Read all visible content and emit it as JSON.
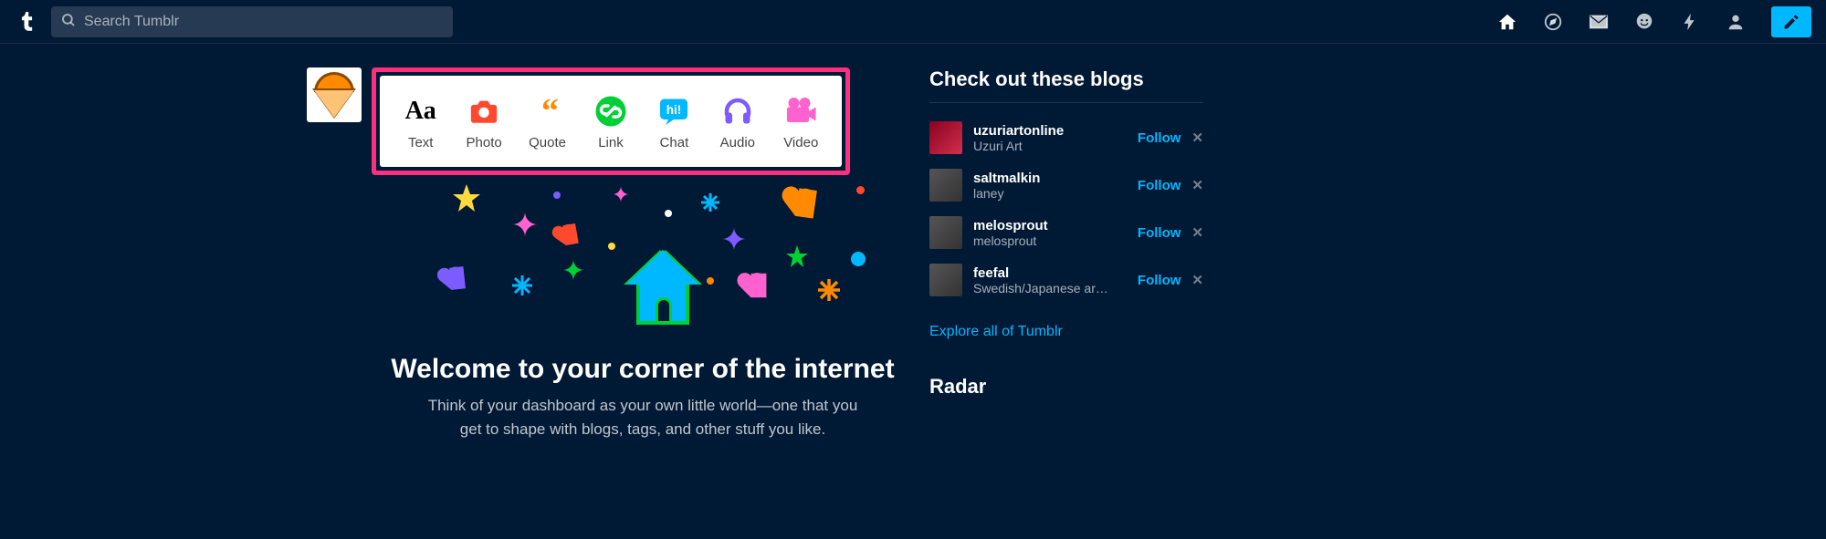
{
  "search": {
    "placeholder": "Search Tumblr"
  },
  "compose": {
    "items": [
      {
        "label": "Text"
      },
      {
        "label": "Photo"
      },
      {
        "label": "Quote"
      },
      {
        "label": "Link"
      },
      {
        "label": "Chat"
      },
      {
        "label": "Audio"
      },
      {
        "label": "Video"
      }
    ]
  },
  "welcome": {
    "title": "Welcome to your corner of the internet",
    "subtitle": "Think of your dashboard as your own little world—one that you get to shape with blogs, tags, and other stuff you like."
  },
  "sidebar": {
    "title": "Check out these blogs",
    "follow_label": "Follow",
    "dismiss_label": "✕",
    "explore_label": "Explore all of Tumblr",
    "radar_title": "Radar",
    "blogs": [
      {
        "name": "uzuriartonline",
        "sub": "Uzuri Art"
      },
      {
        "name": "saltmalkin",
        "sub": "laney"
      },
      {
        "name": "melosprout",
        "sub": "melosprout"
      },
      {
        "name": "feefal",
        "sub": "Swedish/Japanese arti..."
      }
    ]
  }
}
